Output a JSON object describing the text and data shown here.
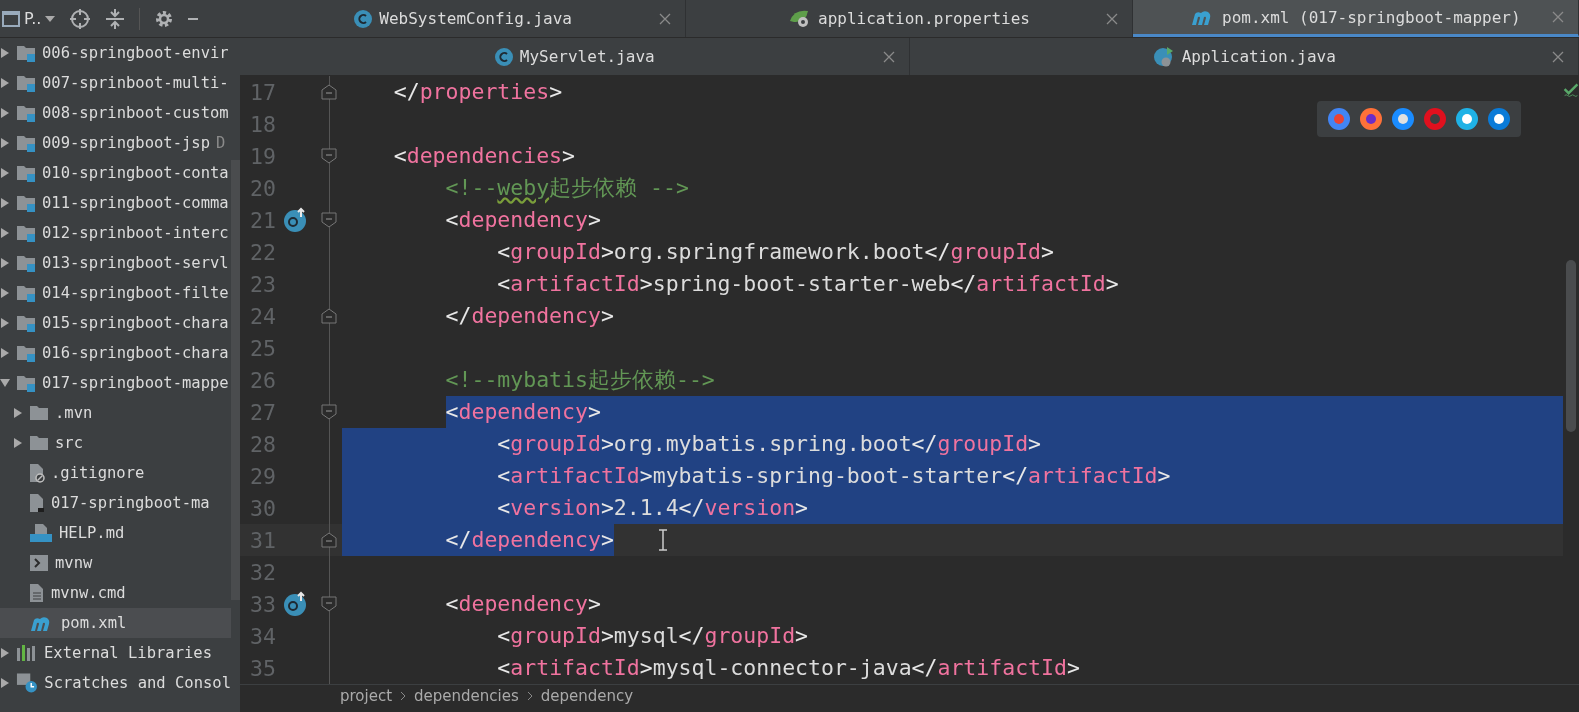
{
  "project_panel": {
    "title": "P..",
    "tree": [
      {
        "label": "006-springboot-envir",
        "kind": "module",
        "expanded": false,
        "selected": false
      },
      {
        "label": "007-sprinboot-multi-",
        "kind": "module",
        "expanded": false,
        "selected": false
      },
      {
        "label": "008-sprinboot-custom",
        "kind": "module",
        "expanded": false,
        "selected": false
      },
      {
        "label": "009-springboot-jsp",
        "note": "D",
        "kind": "module",
        "expanded": false,
        "selected": false
      },
      {
        "label": "010-springboot-conta",
        "kind": "module",
        "expanded": false,
        "selected": false
      },
      {
        "label": "011-springboot-comma",
        "kind": "module",
        "expanded": false,
        "selected": false
      },
      {
        "label": "012-sprinboot-interc",
        "kind": "module",
        "expanded": false,
        "selected": false
      },
      {
        "label": "013-springboot-servl",
        "kind": "module",
        "expanded": false,
        "selected": false
      },
      {
        "label": "014-springboot-filte",
        "kind": "module",
        "expanded": false,
        "selected": false
      },
      {
        "label": "015-springboot-chara",
        "kind": "module",
        "expanded": false,
        "selected": false
      },
      {
        "label": "016-springboot-chara",
        "kind": "module",
        "expanded": false,
        "selected": false
      },
      {
        "label": "017-springboot-mappe",
        "kind": "module",
        "expanded": true,
        "selected": false,
        "children": [
          {
            "label": ".mvn",
            "kind": "folder",
            "expanded": false,
            "selected": false
          },
          {
            "label": "src",
            "kind": "folder",
            "expanded": false,
            "selected": false
          },
          {
            "label": ".gitignore",
            "kind": "ignore",
            "selected": false
          },
          {
            "label": "017-springboot-ma",
            "kind": "iml",
            "selected": false
          },
          {
            "label": "HELP.md",
            "kind": "markdown",
            "selected": false
          },
          {
            "label": "mvnw",
            "kind": "script",
            "selected": false
          },
          {
            "label": "mvnw.cmd",
            "kind": "text",
            "selected": false
          },
          {
            "label": "pom.xml",
            "kind": "maven",
            "selected": true
          }
        ]
      },
      {
        "label": "External Libraries",
        "kind": "libraries",
        "expanded": false,
        "selected": false
      },
      {
        "label": "Scratches and Consol",
        "kind": "scratches",
        "expanded": false,
        "selected": false
      }
    ]
  },
  "tab_rows": [
    {
      "tabs": [
        {
          "label": "WebSystemConfig.java",
          "kind": "class",
          "selected": false
        },
        {
          "label": "application.properties",
          "kind": "properties",
          "selected": false
        },
        {
          "label": "pom.xml (017-springboot-mapper)",
          "kind": "maven",
          "selected": true
        }
      ]
    },
    {
      "tabs": [
        {
          "label": "MyServlet.java",
          "kind": "class",
          "selected": false
        },
        {
          "label": "Application.java",
          "kind": "app",
          "selected": false
        }
      ]
    }
  ],
  "editor": {
    "lines": [
      {
        "n": "17",
        "fold_start": false,
        "fold_end": true,
        "tokens": [
          {
            "kind": "p",
            "text": "    </"
          },
          {
            "kind": "tag",
            "text": "properties"
          },
          {
            "kind": "p",
            "text": ">"
          }
        ]
      },
      {
        "n": "18"
      },
      {
        "n": "19",
        "fold_start": true,
        "fold_end": false,
        "tokens": [
          {
            "kind": "p",
            "text": "    <"
          },
          {
            "kind": "tag",
            "text": "dependencies"
          },
          {
            "kind": "p",
            "text": ">"
          }
        ]
      },
      {
        "n": "20",
        "tokens": [
          {
            "kind": "c",
            "text": "        <!--"
          },
          {
            "kind": "typo",
            "text": "weby"
          },
          {
            "kind": "c",
            "text": "起步依赖 -->"
          }
        ]
      },
      {
        "n": "21",
        "fold_start": true,
        "fold_end": false,
        "gutter_icon": true,
        "tokens": [
          {
            "kind": "p",
            "text": "        <"
          },
          {
            "kind": "tag",
            "text": "dependency"
          },
          {
            "kind": "p",
            "text": ">"
          }
        ]
      },
      {
        "n": "22",
        "tokens": [
          {
            "kind": "p",
            "text": "            <"
          },
          {
            "kind": "tag",
            "text": "groupId"
          },
          {
            "kind": "p",
            "text": ">"
          },
          {
            "kind": "t",
            "text": "org.springframework.boot"
          },
          {
            "kind": "p",
            "text": "</"
          },
          {
            "kind": "tag",
            "text": "groupId"
          },
          {
            "kind": "p",
            "text": ">"
          }
        ]
      },
      {
        "n": "23",
        "tokens": [
          {
            "kind": "p",
            "text": "            <"
          },
          {
            "kind": "tag",
            "text": "artifactId"
          },
          {
            "kind": "p",
            "text": ">"
          },
          {
            "kind": "t",
            "text": "spring-boot-starter-web"
          },
          {
            "kind": "p",
            "text": "</"
          },
          {
            "kind": "tag",
            "text": "artifactId"
          },
          {
            "kind": "p",
            "text": ">"
          }
        ]
      },
      {
        "n": "24",
        "fold_start": false,
        "fold_end": true,
        "tokens": [
          {
            "kind": "p",
            "text": "        </"
          },
          {
            "kind": "tag",
            "text": "dependency"
          },
          {
            "kind": "p",
            "text": ">"
          }
        ]
      },
      {
        "n": "25"
      },
      {
        "n": "26",
        "tokens": [
          {
            "kind": "c",
            "text": "        <!--mybatis起步依赖-->"
          }
        ]
      },
      {
        "n": "27",
        "fold_start": true,
        "fold_end": false,
        "indent_selected": false,
        "text_selected": true,
        "tail_selected": true,
        "tokens": [
          {
            "kind": "p",
            "text": "        <"
          },
          {
            "kind": "tag",
            "text": "dependency"
          },
          {
            "kind": "p",
            "text": ">"
          }
        ]
      },
      {
        "n": "28",
        "indent_selected": true,
        "text_selected": true,
        "tail_selected": true,
        "tokens": [
          {
            "kind": "p",
            "text": "            <"
          },
          {
            "kind": "tag",
            "text": "groupId"
          },
          {
            "kind": "p",
            "text": ">"
          },
          {
            "kind": "t",
            "text": "org.mybatis.spring.boot"
          },
          {
            "kind": "p",
            "text": "</"
          },
          {
            "kind": "tag",
            "text": "groupId"
          },
          {
            "kind": "p",
            "text": ">"
          }
        ]
      },
      {
        "n": "29",
        "indent_selected": true,
        "text_selected": true,
        "tail_selected": true,
        "tokens": [
          {
            "kind": "p",
            "text": "            <"
          },
          {
            "kind": "tag",
            "text": "artifactId"
          },
          {
            "kind": "p",
            "text": ">"
          },
          {
            "kind": "t",
            "text": "mybatis-spring-boot-starter"
          },
          {
            "kind": "p",
            "text": "</"
          },
          {
            "kind": "tag",
            "text": "artifactId"
          },
          {
            "kind": "p",
            "text": ">"
          }
        ]
      },
      {
        "n": "30",
        "indent_selected": true,
        "text_selected": true,
        "tail_selected": true,
        "tokens": [
          {
            "kind": "p",
            "text": "            <"
          },
          {
            "kind": "tag",
            "text": "version"
          },
          {
            "kind": "p",
            "text": ">"
          },
          {
            "kind": "t",
            "text": "2.1.4"
          },
          {
            "kind": "p",
            "text": "</"
          },
          {
            "kind": "tag",
            "text": "version"
          },
          {
            "kind": "p",
            "text": ">"
          }
        ]
      },
      {
        "n": "31",
        "fold_start": false,
        "fold_end": true,
        "indent_selected": true,
        "text_selected": true,
        "tail_selected": false,
        "current": true,
        "tokens": [
          {
            "kind": "p",
            "text": "        </"
          },
          {
            "kind": "tag",
            "text": "dependency"
          },
          {
            "kind": "p",
            "text": ">"
          }
        ]
      },
      {
        "n": "32"
      },
      {
        "n": "33",
        "fold_start": true,
        "fold_end": false,
        "gutter_icon": true,
        "tokens": [
          {
            "kind": "p",
            "text": "        <"
          },
          {
            "kind": "tag",
            "text": "dependency"
          },
          {
            "kind": "p",
            "text": ">"
          }
        ]
      },
      {
        "n": "34",
        "tokens": [
          {
            "kind": "p",
            "text": "            <"
          },
          {
            "kind": "tag",
            "text": "groupId"
          },
          {
            "kind": "p",
            "text": ">"
          },
          {
            "kind": "t",
            "text": "mysql"
          },
          {
            "kind": "p",
            "text": "</"
          },
          {
            "kind": "tag",
            "text": "groupId"
          },
          {
            "kind": "p",
            "text": ">"
          }
        ]
      },
      {
        "n": "35",
        "tokens": [
          {
            "kind": "p",
            "text": "            <"
          },
          {
            "kind": "tag",
            "text": "artifactId"
          },
          {
            "kind": "p",
            "text": ">"
          },
          {
            "kind": "t",
            "text": "mysql-connector-java"
          },
          {
            "kind": "p",
            "text": "</"
          },
          {
            "kind": "tag",
            "text": "artifactId"
          },
          {
            "kind": "p",
            "text": ">"
          }
        ]
      }
    ],
    "breadcrumb": [
      "project",
      "dependencies",
      "dependency"
    ]
  }
}
